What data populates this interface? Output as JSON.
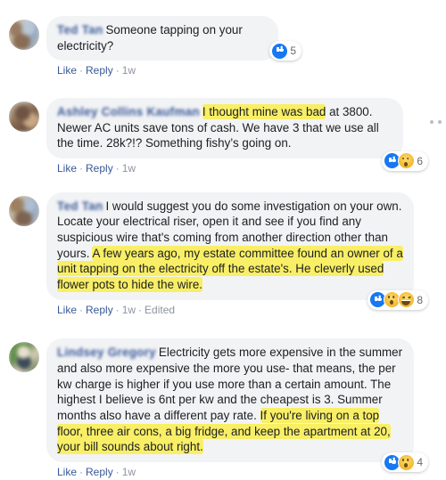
{
  "thread": {
    "comments": [
      {
        "id": "comment-1",
        "author": "Ted Tan",
        "avatar": "blurred-profile-photo",
        "segments": [
          {
            "text": "Someone tapping on your electricity?",
            "highlight": false
          }
        ],
        "actions": {
          "like": "Like",
          "reply": "Reply",
          "time": "1w",
          "edited": ""
        },
        "reactions": {
          "types": [
            "like"
          ],
          "count": "5"
        },
        "more_menu": "more-options"
      },
      {
        "id": "comment-2",
        "author": "Ashley Collins Kaufman",
        "avatar": "blurred-profile-photo",
        "segments": [
          {
            "text": "I thought mine was bad",
            "highlight": true
          },
          {
            "text": " at 3800. Newer AC units save tons of cash. We have 3 that we use all the time. 28k?!? Something fishy’s going on.",
            "highlight": false
          }
        ],
        "actions": {
          "like": "Like",
          "reply": "Reply",
          "time": "1w",
          "edited": ""
        },
        "reactions": {
          "types": [
            "like",
            "wow"
          ],
          "count": "6"
        },
        "more_menu": "more-options"
      },
      {
        "id": "comment-3",
        "author": "Ted Tan",
        "avatar": "blurred-profile-photo",
        "segments": [
          {
            "text": "I would suggest you do some investigation on your own. Locate your electrical riser, open it and see if you find any suspicious wire that's coming from another direction other than yours. ",
            "highlight": false
          },
          {
            "text": "A few years ago, my estate committee found an owner of a unit tapping on the electricity off the estate's. He cleverly used flower pots to hide the wire.",
            "highlight": true
          }
        ],
        "actions": {
          "like": "Like",
          "reply": "Reply",
          "time": "1w",
          "edited": "Edited"
        },
        "reactions": {
          "types": [
            "like",
            "wow",
            "haha"
          ],
          "count": "8"
        },
        "more_menu": "more-options"
      },
      {
        "id": "comment-4",
        "author": "Lindsey Gregory",
        "avatar": "blurred-profile-photo",
        "segments": [
          {
            "text": "Electricity gets more expensive in the summer and also more expensive the more you use- that means, the per kw charge is higher if you use more than a certain amount. The highest I believe is 6nt per kw and the cheapest is 3. Summer months also have a different pay rate. ",
            "highlight": false
          },
          {
            "text": "If you're living on a top floor, three air cons, a big fridge, and keep the apartment at 20, your bill sounds about right.",
            "highlight": true
          }
        ],
        "actions": {
          "like": "Like",
          "reply": "Reply",
          "time": "1w",
          "edited": ""
        },
        "reactions": {
          "types": [
            "like",
            "wow"
          ],
          "count": "4"
        },
        "more_menu": "more-options"
      }
    ],
    "colors": {
      "bubble_background": "#f2f3f5",
      "highlight": "#f9ef66",
      "link": "#385898",
      "meta": "#8d949e",
      "reaction_like_blue": "#1778f2",
      "reaction_emoji_yellow": "#f3b52c"
    },
    "separators": {
      "dot": "·"
    }
  }
}
